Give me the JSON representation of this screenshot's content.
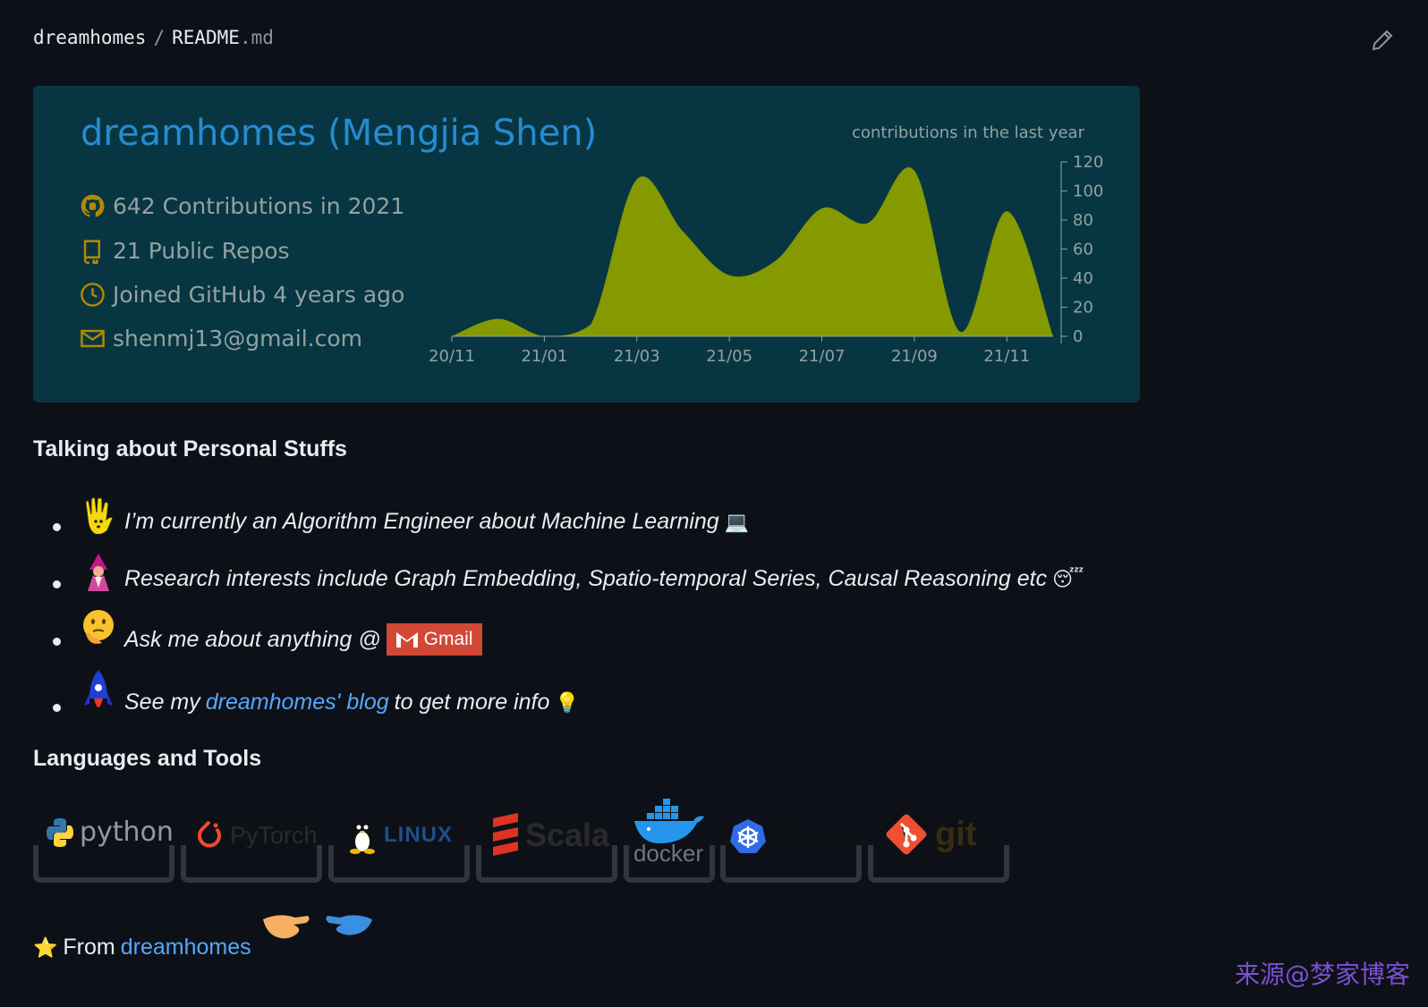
{
  "breadcrumb": {
    "owner": "dreamhomes",
    "sep": "/",
    "file": "README",
    "ext": ".md"
  },
  "card": {
    "title": "dreamhomes (Mengjia Shen)",
    "stats": [
      {
        "icon": "github-icon",
        "label": "642 Contributions in 2021"
      },
      {
        "icon": "repo-icon",
        "label": "21 Public Repos"
      },
      {
        "icon": "clock-icon",
        "label": "Joined GitHub 4 years ago"
      },
      {
        "icon": "mail-icon",
        "label": "shenmj13@gmail.com"
      }
    ],
    "colors": {
      "bg": "#073642",
      "title": "#268bd2",
      "text": "#93a1a1",
      "icon": "#b58900",
      "area": "#859900"
    }
  },
  "chart_data": {
    "type": "area",
    "title": "contributions in the last year",
    "xlabel": "",
    "ylabel": "",
    "x_ticks": [
      "20/11",
      "21/01",
      "21/03",
      "21/05",
      "21/07",
      "21/09",
      "21/11"
    ],
    "x": [
      "20/11",
      "20/12",
      "21/01",
      "21/02",
      "21/03",
      "21/04",
      "21/05",
      "21/06",
      "21/07",
      "21/08",
      "21/09",
      "21/10",
      "21/11",
      "21/12"
    ],
    "values": [
      0,
      12,
      0,
      8,
      108,
      72,
      42,
      52,
      88,
      78,
      114,
      3,
      86,
      0
    ],
    "y_ticks": [
      0,
      20,
      40,
      60,
      80,
      100,
      120
    ],
    "ylim": [
      0,
      120
    ],
    "grid": false,
    "legend": "none"
  },
  "sections": {
    "personal_title": "Talking about Personal Stuffs",
    "tools_title": "Languages and Tools"
  },
  "personal_items": [
    {
      "icon": "raised-hand-icon",
      "text": "I’m currently an Algorithm Engineer about Machine Learning",
      "trail": "💻"
    },
    {
      "icon": "mage-icon",
      "text": "Research interests include Graph Embedding, Spatio-temporal Series, Causal Reasoning etc",
      "trail": "😴"
    },
    {
      "icon": "thinking-face-icon",
      "text": "Ask me about anything @",
      "badge": "Gmail"
    },
    {
      "icon": "rocket-icon",
      "pre": "See my",
      "link": "dreamhomes' blog",
      "post": "to get more info",
      "trail": "💡"
    }
  ],
  "tools": [
    {
      "name": "python",
      "label": "python"
    },
    {
      "name": "pytorch",
      "label": "PyTorch"
    },
    {
      "name": "linux",
      "label": "LINUX"
    },
    {
      "name": "scala",
      "label": "Scala"
    },
    {
      "name": "docker",
      "label": "docker"
    },
    {
      "name": "kubernetes",
      "label": "kubernetes"
    },
    {
      "name": "git",
      "label": "git"
    }
  ],
  "footer": {
    "star": "⭐️",
    "from": "From",
    "link": "dreamhomes"
  },
  "watermark": "来源@梦家博客"
}
